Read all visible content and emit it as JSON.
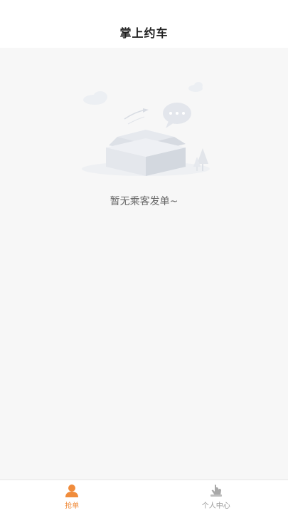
{
  "header": {
    "title": "掌上约车"
  },
  "empty_state": {
    "illustration": "empty-box-illustration",
    "message": "暂无乘客发单~"
  },
  "tabbar": {
    "active_color": "#f08c3c",
    "inactive_color": "#9a9a9a",
    "tabs": [
      {
        "label": "抢单",
        "icon": "person-icon",
        "active": true
      },
      {
        "label": "个人中心",
        "icon": "hand-tap-icon",
        "active": false
      }
    ]
  }
}
